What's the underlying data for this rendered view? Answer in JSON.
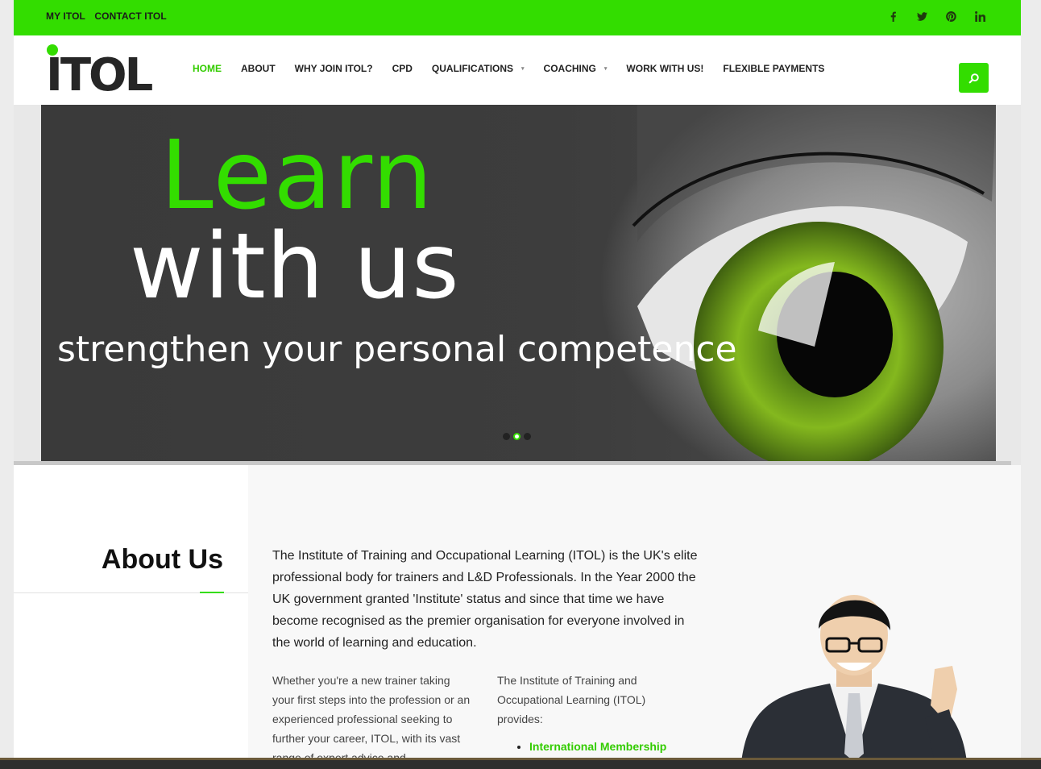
{
  "topbar": {
    "links": [
      "MY ITOL",
      "CONTACT ITOL"
    ],
    "social": [
      "facebook-icon",
      "twitter-icon",
      "pinterest-icon",
      "linkedin-icon"
    ]
  },
  "logo": {
    "text": "ITOL"
  },
  "nav": {
    "items": [
      {
        "label": "HOME",
        "active": true
      },
      {
        "label": "ABOUT"
      },
      {
        "label": "WHY JOIN ITOL?"
      },
      {
        "label": "CPD"
      },
      {
        "label": "QUALIFICATIONS",
        "dropdown": true
      },
      {
        "label": "COACHING",
        "dropdown": true
      },
      {
        "label": "WORK WITH US!"
      },
      {
        "label": "FLEXIBLE PAYMENTS"
      }
    ],
    "search_icon": "search-icon"
  },
  "hero": {
    "line1": "Learn",
    "line2": "with us",
    "line3": "strengthen your personal competence",
    "slides": 3,
    "active_slide": 2
  },
  "about": {
    "title": "About Us",
    "intro": "The Institute of Training and Occupational Learning (ITOL) is the UK's elite professional body for trainers and L&D Professionals. In the Year 2000 the UK government granted 'Institute' status and since that time we have become recognised as the premier organisation for everyone involved in the world of learning and education.",
    "col1": "Whether you're a new trainer taking your first steps into the profession or an experienced professional seeking to further your career, ITOL, with its vast range of expert advice and",
    "col2": "The Institute of Training and Occupational Learning (ITOL) provides:",
    "col2_list": [
      "International Membership"
    ]
  },
  "colors": {
    "accent": "#33dd00",
    "dark": "#262626"
  }
}
